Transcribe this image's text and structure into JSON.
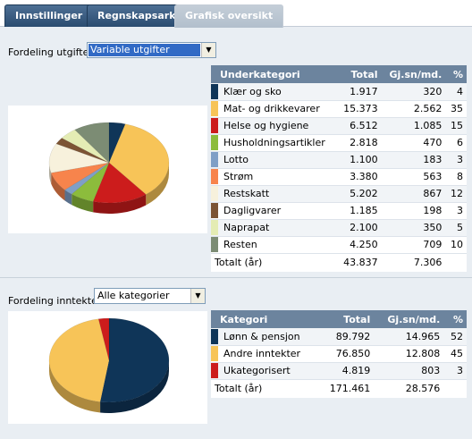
{
  "tabs": [
    {
      "label": "Innstillinger"
    },
    {
      "label": "Regnskapsark"
    },
    {
      "label": "Grafisk oversikt"
    }
  ],
  "expenses": {
    "label": "Fordeling utgifter",
    "selected": "Variable utgifter",
    "table": {
      "headers": [
        "Underkategori",
        "Total",
        "Gj.sn/md.",
        "%"
      ],
      "rows": [
        {
          "name": "Klær og sko",
          "total": "1.917",
          "avg": "320",
          "pct": "4",
          "color": "#0f3558"
        },
        {
          "name": "Mat- og drikkevarer",
          "total": "15.373",
          "avg": "2.562",
          "pct": "35",
          "color": "#f7c458"
        },
        {
          "name": "Helse og hygiene",
          "total": "6.512",
          "avg": "1.085",
          "pct": "15",
          "color": "#cc1c1c"
        },
        {
          "name": "Husholdningsartikler",
          "total": "2.818",
          "avg": "470",
          "pct": "6",
          "color": "#8cbc3c"
        },
        {
          "name": "Lotto",
          "total": "1.100",
          "avg": "183",
          "pct": "3",
          "color": "#7f9fc6"
        },
        {
          "name": "Strøm",
          "total": "3.380",
          "avg": "563",
          "pct": "8",
          "color": "#f7844c"
        },
        {
          "name": "Restskatt",
          "total": "5.202",
          "avg": "867",
          "pct": "12",
          "color": "#f7f1dc"
        },
        {
          "name": "Dagligvarer",
          "total": "1.185",
          "avg": "198",
          "pct": "3",
          "color": "#7c5434"
        },
        {
          "name": "Naprapat",
          "total": "2.100",
          "avg": "350",
          "pct": "5",
          "color": "#e4ecb4"
        },
        {
          "name": "Resten",
          "total": "4.250",
          "avg": "709",
          "pct": "10",
          "color": "#7c8c74"
        }
      ],
      "total_label": "Totalt (år)",
      "total_value": "43.837",
      "total_avg": "7.306"
    }
  },
  "income": {
    "label": "Fordeling inntekter",
    "selected": "Alle kategorier",
    "table": {
      "headers": [
        "Kategori",
        "Total",
        "Gj.sn/md.",
        "%"
      ],
      "rows": [
        {
          "name": "Lønn & pensjon",
          "total": "89.792",
          "avg": "14.965",
          "pct": "52",
          "color": "#0f3558"
        },
        {
          "name": "Andre inntekter",
          "total": "76.850",
          "avg": "12.808",
          "pct": "45",
          "color": "#f7c458"
        },
        {
          "name": "Ukategorisert",
          "total": "4.819",
          "avg": "803",
          "pct": "3",
          "color": "#cc1c1c"
        }
      ],
      "total_label": "Totalt (år)",
      "total_value": "171.461",
      "total_avg": "28.576"
    }
  },
  "chart_data": [
    {
      "type": "pie",
      "categories": [
        "Klær og sko",
        "Mat- og drikkevarer",
        "Helse og hygiene",
        "Husholdningsartikler",
        "Lotto",
        "Strøm",
        "Restskatt",
        "Dagligvarer",
        "Naprapat",
        "Resten"
      ],
      "values": [
        1917,
        15373,
        6512,
        2818,
        1100,
        3380,
        5202,
        1185,
        2100,
        4250
      ],
      "colors": [
        "#0f3558",
        "#f7c458",
        "#cc1c1c",
        "#8cbc3c",
        "#7f9fc6",
        "#f7844c",
        "#f7f1dc",
        "#7c5434",
        "#e4ecb4",
        "#7c8c74"
      ]
    },
    {
      "type": "pie",
      "categories": [
        "Lønn & pensjon",
        "Andre inntekter",
        "Ukategorisert"
      ],
      "values": [
        89792,
        76850,
        4819
      ],
      "colors": [
        "#0f3558",
        "#f7c458",
        "#cc1c1c"
      ]
    }
  ]
}
